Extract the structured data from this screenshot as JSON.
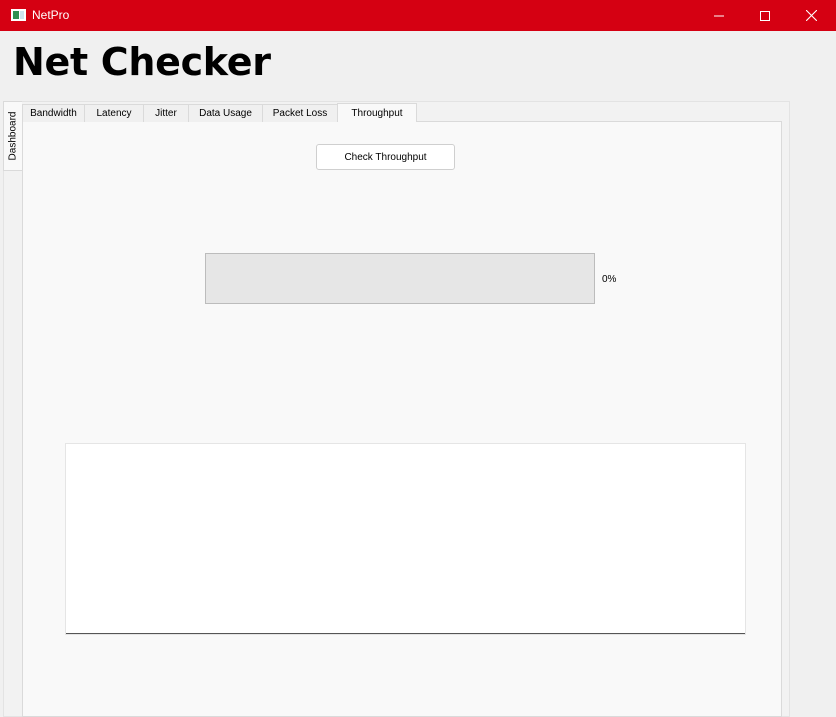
{
  "window": {
    "title": "NetPro",
    "accent_color": "#d50012"
  },
  "app": {
    "heading": "Net Checker"
  },
  "side_tabs": [
    "Dashboard"
  ],
  "tabs": [
    {
      "label": "Bandwidth",
      "active": false
    },
    {
      "label": "Latency",
      "active": false
    },
    {
      "label": "Jitter",
      "active": false
    },
    {
      "label": "Data Usage",
      "active": false
    },
    {
      "label": "Packet Loss",
      "active": false
    },
    {
      "label": "Throughput",
      "active": true
    }
  ],
  "throughput": {
    "check_button_label": "Check Throughput",
    "progress_percent": 0,
    "progress_text": "0%"
  },
  "icons": {
    "app": "app-icon",
    "minimize": "minimize-icon",
    "maximize": "maximize-icon",
    "close": "close-icon"
  }
}
